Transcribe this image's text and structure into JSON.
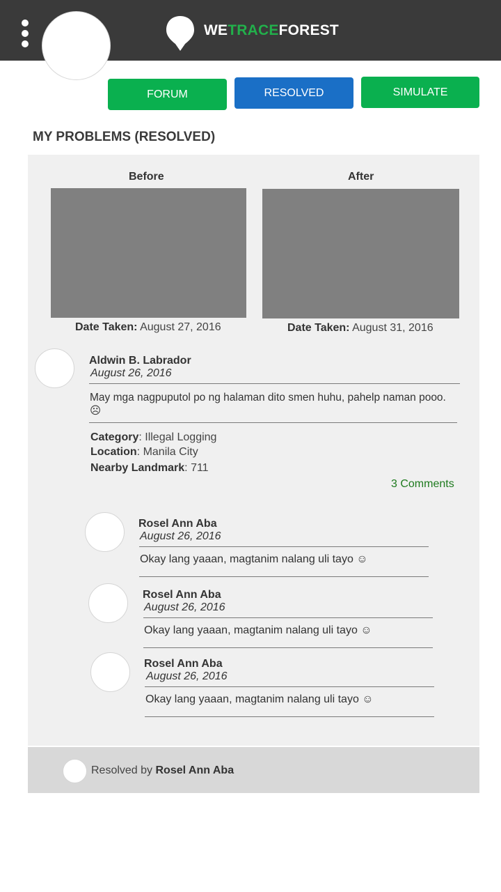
{
  "header": {
    "logo_part1": "WE",
    "logo_part2": "TRACE",
    "logo_part3": "FOREST",
    "colors": {
      "bar": "#3a3a3a",
      "accent_green": "#22b04b"
    }
  },
  "nav": {
    "forum_label": "FORUM",
    "resolved_label": "RESOLVED",
    "simulate_label": "SIMULATE"
  },
  "section_title": "MY PROBLEMS (RESOLVED)",
  "photos": {
    "before_label": "Before",
    "after_label": "After",
    "date_taken_label": "Date Taken:",
    "before_date": "August 27, 2016",
    "after_date": "August 31, 2016"
  },
  "post": {
    "author": "Aldwin B. Labrador",
    "date": "August 26, 2016",
    "body": "May mga nagpuputol po ng halaman dito smen huhu, pahelp naman pooo. ☹",
    "category_label": "Category",
    "category": "Illegal Logging",
    "location_label": "Location",
    "location": "Manila City",
    "landmark_label": "Nearby Landmark",
    "landmark": "711",
    "comments_link": "3 Comments"
  },
  "comments": [
    {
      "author": "Rosel Ann Aba",
      "date": "August 26, 2016",
      "text": "Okay lang yaaan, magtanim nalang uli tayo ☺"
    },
    {
      "author": "Rosel Ann Aba",
      "date": "August 26, 2016",
      "text": "Okay lang yaaan, magtanim nalang uli tayo ☺"
    },
    {
      "author": "Rosel Ann Aba",
      "date": "August 26, 2016",
      "text": "Okay lang yaaan, magtanim nalang uli tayo ☺"
    }
  ],
  "resolved": {
    "prefix": "Resolved by",
    "name": "Rosel Ann Aba"
  }
}
